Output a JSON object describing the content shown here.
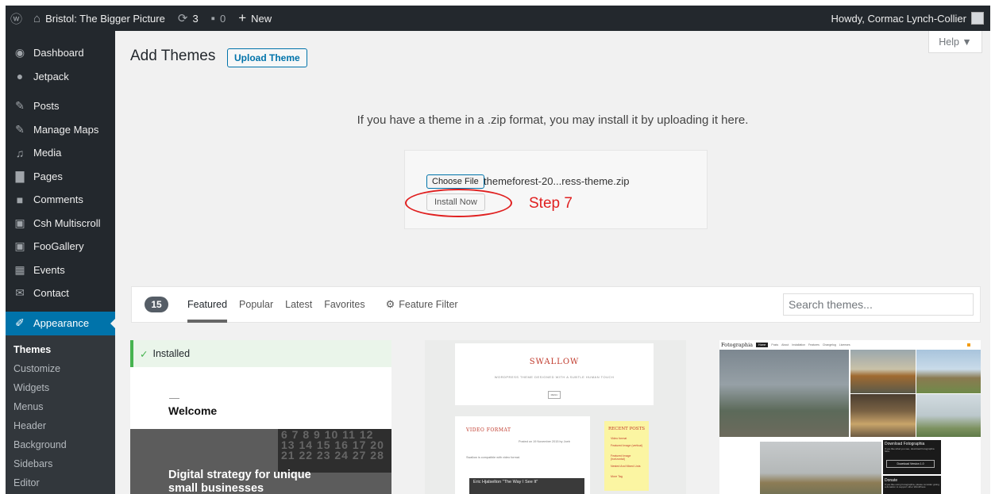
{
  "admin_bar": {
    "site_name": "Bristol: The Bigger Picture",
    "updates_count": "3",
    "comments_count": "0",
    "new_label": "New",
    "greeting": "Howdy, Cormac Lynch-Collier"
  },
  "sidebar": {
    "items": [
      {
        "label": "Dashboard",
        "icon": "dashboard-icon"
      },
      {
        "label": "Jetpack",
        "icon": "jetpack-icon"
      },
      {
        "label": "Posts",
        "icon": "pin-icon"
      },
      {
        "label": "Manage Maps",
        "icon": "pin-icon"
      },
      {
        "label": "Media",
        "icon": "media-icon"
      },
      {
        "label": "Pages",
        "icon": "pages-icon"
      },
      {
        "label": "Comments",
        "icon": "comment-icon"
      },
      {
        "label": "Csh Multiscroll",
        "icon": "gallery-icon"
      },
      {
        "label": "FooGallery",
        "icon": "gallery-icon"
      },
      {
        "label": "Events",
        "icon": "calendar-icon"
      },
      {
        "label": "Contact",
        "icon": "mail-icon"
      }
    ],
    "active": {
      "label": "Appearance",
      "icon": "brush-icon"
    },
    "submenu": [
      "Themes",
      "Customize",
      "Widgets",
      "Menus",
      "Header",
      "Background",
      "Sidebars",
      "Editor"
    ]
  },
  "help": {
    "label": "Help ▼"
  },
  "page": {
    "title": "Add Themes",
    "upload_button": "Upload Theme",
    "upload_instructions": "If you have a theme in a .zip format, you may install it by uploading it here.",
    "choose_file_label": "Choose File",
    "file_name": "themeforest-20...ress-theme.zip",
    "install_button": "Install Now",
    "annotation": "Step 7"
  },
  "filter": {
    "count": "15",
    "tabs": [
      "Featured",
      "Popular",
      "Latest",
      "Favorites"
    ],
    "feature_filter": "Feature Filter",
    "search_placeholder": "Search themes..."
  },
  "themes": {
    "one": {
      "status": "Installed",
      "welcome": "Welcome",
      "heading": "Digital strategy for unique small businesses",
      "calendar": "6 7 8 9 10 11 12 13 14 15 16 17 20 21 22 23 24 27 28"
    },
    "two": {
      "title": "SWALLOW",
      "tagline": "WORDPRESS THEME DESIGNED WITH A SUBTLE HUMAN TOUCH",
      "menu": "MENU",
      "post_title": "VIDEO FORMAT",
      "post_meta": "Posted on 19 November 2015 by Joeb",
      "post_text": "Swallow is compatible with video format.",
      "video_label": "Eric Hjalselton \"The Way I See It\"",
      "recent_title": "RECENT POSTS",
      "recent_links": [
        "Video format",
        "Featured Image (vertical)",
        "Featured Image (horizontal)",
        "Nested And Mixed Lists",
        "More Tag"
      ]
    },
    "three": {
      "brand": "Fotographia",
      "nav": [
        "Home",
        "Posts",
        "About",
        "Installation",
        "Features",
        "Changelog",
        "Licenses"
      ],
      "download_title": "Download Fotographia",
      "download_note": "If you like what you see, download Fotographia here.",
      "download_button": "Download Version 1.0",
      "donate_title": "Donate",
      "donate_note": "If you like using Fotographia, please consider giving a donation to support other WordPress"
    }
  },
  "colors": {
    "admin_dark": "#23282d",
    "accent": "#0073aa",
    "annotation_red": "#e02020",
    "installed_green": "#46b450"
  }
}
